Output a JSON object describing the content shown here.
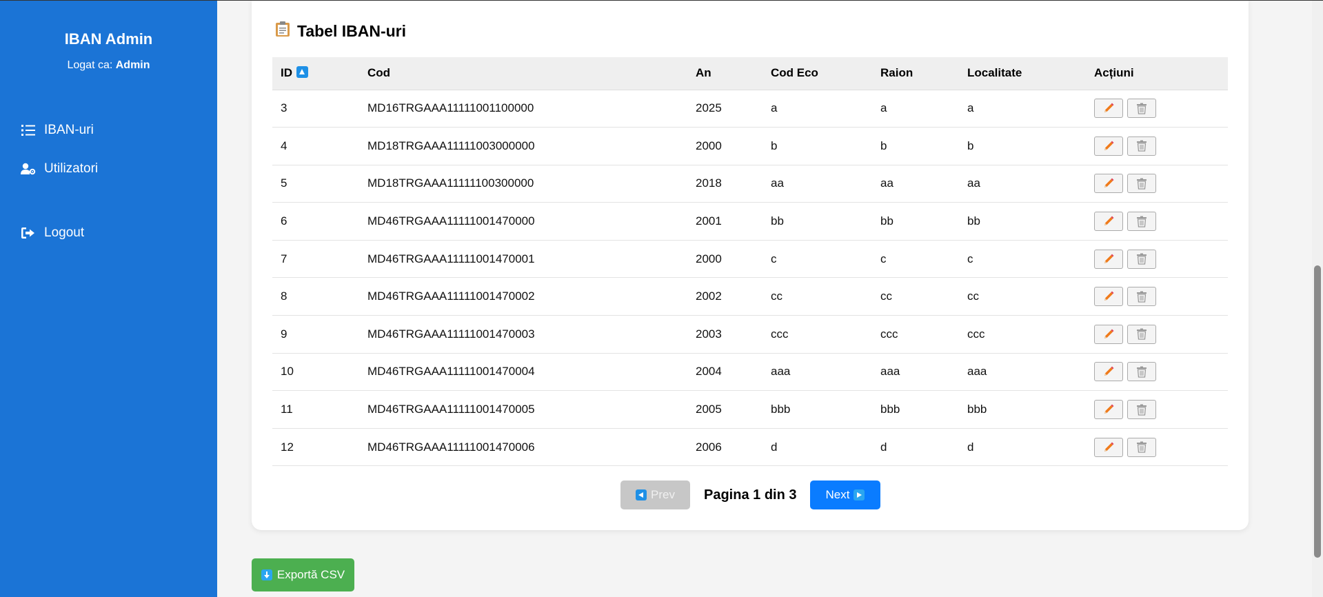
{
  "sidebar": {
    "brand": "IBAN Admin",
    "logged_prefix": "Logat ca: ",
    "logged_user": "Admin",
    "nav": [
      {
        "label": "IBAN-uri",
        "icon": "list-icon"
      },
      {
        "label": "Utilizatori",
        "icon": "users-cog-icon"
      },
      {
        "label": "Logout",
        "icon": "sign-out-icon"
      }
    ]
  },
  "card": {
    "title": "Tabel IBAN-uri",
    "title_icon": "clipboard-icon"
  },
  "table": {
    "headers": [
      "ID",
      "Cod",
      "An",
      "Cod Eco",
      "Raion",
      "Localitate",
      "Acțiuni"
    ],
    "sort_icon": "sort-up-icon",
    "rows": [
      {
        "id": "3",
        "cod": "MD16TRGAAA11111001100000",
        "an": "2025",
        "cod_eco": "a",
        "raion": "a",
        "localitate": "a"
      },
      {
        "id": "4",
        "cod": "MD18TRGAAA11111003000000",
        "an": "2000",
        "cod_eco": "b",
        "raion": "b",
        "localitate": "b"
      },
      {
        "id": "5",
        "cod": "MD18TRGAAA11111100300000",
        "an": "2018",
        "cod_eco": "aa",
        "raion": "aa",
        "localitate": "aa"
      },
      {
        "id": "6",
        "cod": "MD46TRGAAA11111001470000",
        "an": "2001",
        "cod_eco": "bb",
        "raion": "bb",
        "localitate": "bb"
      },
      {
        "id": "7",
        "cod": "MD46TRGAAA11111001470001",
        "an": "2000",
        "cod_eco": "c",
        "raion": "c",
        "localitate": "c"
      },
      {
        "id": "8",
        "cod": "MD46TRGAAA11111001470002",
        "an": "2002",
        "cod_eco": "cc",
        "raion": "cc",
        "localitate": "cc"
      },
      {
        "id": "9",
        "cod": "MD46TRGAAA11111001470003",
        "an": "2003",
        "cod_eco": "ccc",
        "raion": "ccc",
        "localitate": "ccc"
      },
      {
        "id": "10",
        "cod": "MD46TRGAAA11111001470004",
        "an": "2004",
        "cod_eco": "aaa",
        "raion": "aaa",
        "localitate": "aaa"
      },
      {
        "id": "11",
        "cod": "MD46TRGAAA11111001470005",
        "an": "2005",
        "cod_eco": "bbb",
        "raion": "bbb",
        "localitate": "bbb"
      },
      {
        "id": "12",
        "cod": "MD46TRGAAA11111001470006",
        "an": "2006",
        "cod_eco": "d",
        "raion": "d",
        "localitate": "d"
      }
    ],
    "row_actions": [
      {
        "name": "edit",
        "icon": "pencil-icon"
      },
      {
        "name": "delete",
        "icon": "trash-icon"
      }
    ]
  },
  "pagination": {
    "prev_label": "Prev",
    "next_label": "Next",
    "page_text": "Pagina 1 din 3",
    "current_page": 1,
    "total_pages": 3
  },
  "export": {
    "label": "Exportă CSV",
    "icon": "download-icon"
  },
  "colors": {
    "sidebar": "#1b74d6",
    "primary": "#0a7cff",
    "export": "#4caf50",
    "disabled": "#c7c7c7",
    "edit_icon": "#f07a1a"
  }
}
